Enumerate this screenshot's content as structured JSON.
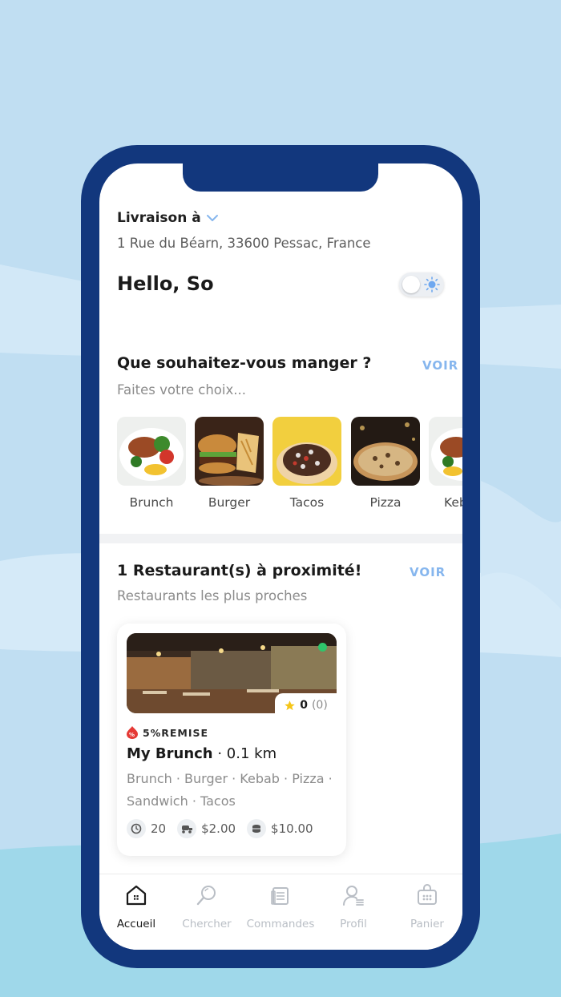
{
  "colors": {
    "background": "#c0def2",
    "phone_frame": "#12377d",
    "accent": "#86b6ee",
    "online": "#2fc46b",
    "promo": "#e53935"
  },
  "header": {
    "delivery_label": "Livraison à",
    "address": "1 Rue du Béarn, 33600 Pessac, France",
    "greeting": "Hello, So",
    "theme_toggle_icon": "sun-icon"
  },
  "categories_section": {
    "title": "Que souhaitez-vous manger ?",
    "subtitle": "Faites votre choix...",
    "see_all": "VOIR",
    "items": [
      {
        "label": "Brunch"
      },
      {
        "label": "Burger"
      },
      {
        "label": "Tacos"
      },
      {
        "label": "Pizza"
      },
      {
        "label": "Kebab"
      }
    ]
  },
  "restaurants_section": {
    "title": "1 Restaurant(s) à proximité!",
    "subtitle": "Restaurants les plus proches",
    "see_all": "VOIR",
    "restaurant": {
      "status": "online",
      "rating": "0",
      "rating_count": "(0)",
      "promo": "5%REMISE",
      "name": "My Brunch",
      "distance": "· 0.1 km",
      "categories": "Brunch · Burger · Kebab · Pizza · Sandwich · Tacos",
      "prep_time": "20",
      "delivery_fee": "$2.00",
      "min_order": "$10.00"
    }
  },
  "tabbar": {
    "tabs": [
      {
        "label": "Accueil",
        "icon": "home-icon",
        "active": true
      },
      {
        "label": "Chercher",
        "icon": "search-icon",
        "active": false
      },
      {
        "label": "Commandes",
        "icon": "orders-icon",
        "active": false
      },
      {
        "label": "Profil",
        "icon": "profile-icon",
        "active": false
      },
      {
        "label": "Panier",
        "icon": "basket-icon",
        "active": false
      }
    ]
  }
}
